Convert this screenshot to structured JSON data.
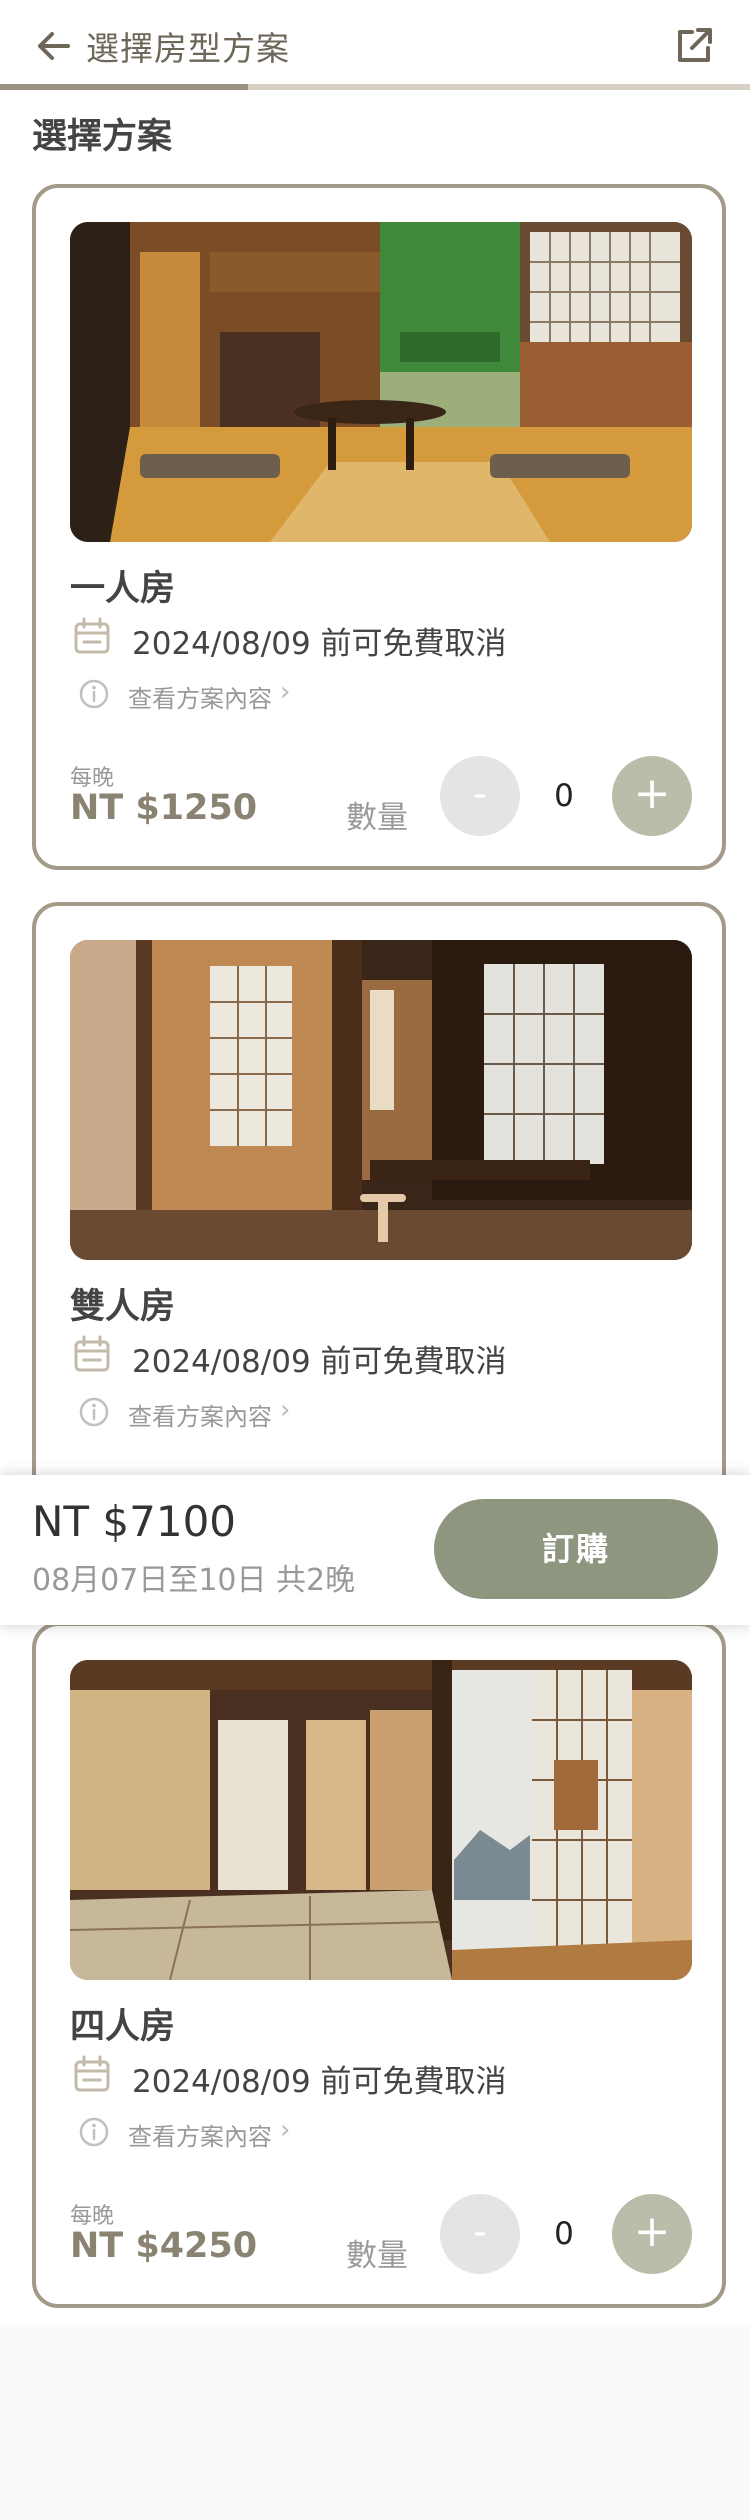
{
  "header": {
    "title": "選擇房型方案",
    "back_icon": "arrow-left-icon",
    "share_icon": "external-link-icon",
    "progress": 0.33
  },
  "section_title": "選擇方案",
  "rooms": [
    {
      "name": "一人房",
      "cancel_policy": "2024/08/09 前可免費取消",
      "plan_link": "查看方案內容",
      "per_night_label": "每晚",
      "price": "NT $1250",
      "qty_label": "數量",
      "qty": "0",
      "minus": "-",
      "plus": "+"
    },
    {
      "name": "雙人房",
      "cancel_policy": "2024/08/09 前可免費取消",
      "plan_link": "查看方案內容"
    },
    {
      "name": "四人房",
      "cancel_policy": "2024/08/09 前可免費取消",
      "plan_link": "查看方案內容",
      "per_night_label": "每晚",
      "price": "NT $4250",
      "qty_label": "數量",
      "qty": "0",
      "minus": "-",
      "plus": "+"
    }
  ],
  "booking": {
    "total": "NT $7100",
    "dates": "08月07日至10日 共2晚",
    "order_label": "訂購"
  },
  "colors": {
    "accent": "#8e9680",
    "card_border": "#a39a88",
    "price": "#8b8372",
    "plus_button": "#b9bda9",
    "minus_button": "#e4e4e4"
  }
}
